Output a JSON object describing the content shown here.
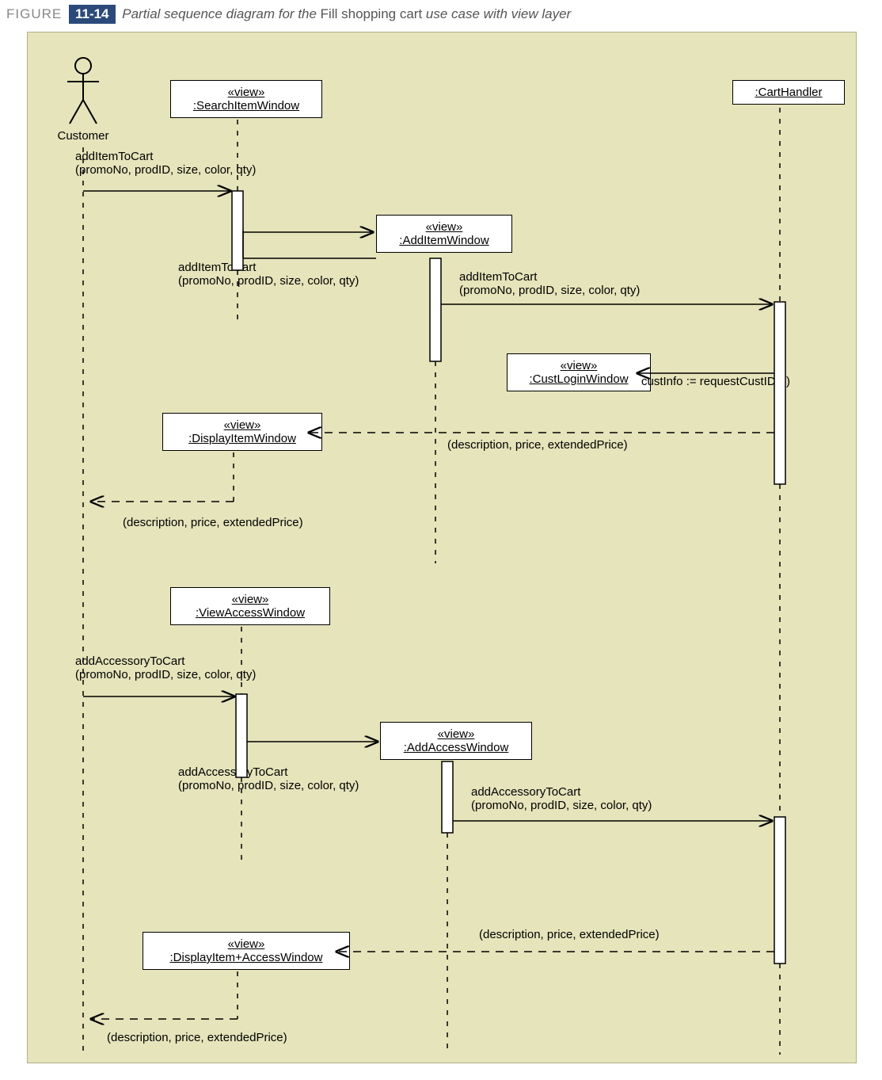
{
  "figure": {
    "label": "FIGURE",
    "number": "11-14",
    "caption_pre": "Partial sequence diagram for the ",
    "caption_mid": "Fill shopping cart",
    "caption_post": " use case with view layer"
  },
  "actor": {
    "name": "Customer"
  },
  "lifelines": {
    "searchItemWindow": {
      "stereo": "«view»",
      "name": ":SearchItemWindow"
    },
    "addItemWindow": {
      "stereo": "«view»",
      "name": ":AddItemWindow"
    },
    "custLoginWindow": {
      "stereo": "«view»",
      "name": ":CustLoginWindow"
    },
    "displayItemWindow": {
      "stereo": "«view»",
      "name": ":DisplayItemWindow"
    },
    "viewAccessWindow": {
      "stereo": "«view»",
      "name": ":ViewAccessWindow"
    },
    "addAccessWindow": {
      "stereo": "«view»",
      "name": ":AddAccessWindow"
    },
    "displayItemAccessWindow": {
      "stereo": "«view»",
      "name": ":DisplayItem+AccessWindow"
    },
    "cartHandler": {
      "name": ":CartHandler"
    }
  },
  "messages": {
    "m1": "addItemToCart\n(promoNo, prodID, size, color, qty)",
    "m2": "addItemToCart\n(promoNo, prodID, size, color, qty)",
    "m3": "addItemToCart\n(promoNo, prodID, size, color, qty)",
    "m4": "custInfo := requestCustID ( )",
    "m5": "(description, price, extendedPrice)",
    "m6": "(description, price, extendedPrice)",
    "m7": "addAccessoryToCart\n(promoNo, prodID, size, color, qty)",
    "m8": "addAccessoryToCart\n(promoNo, prodID, size, color, qty)",
    "m9": "addAccessoryToCart\n(promoNo, prodID, size, color, qty)",
    "m10": "(description, price, extendedPrice)",
    "m11": "(description, price, extendedPrice)"
  }
}
